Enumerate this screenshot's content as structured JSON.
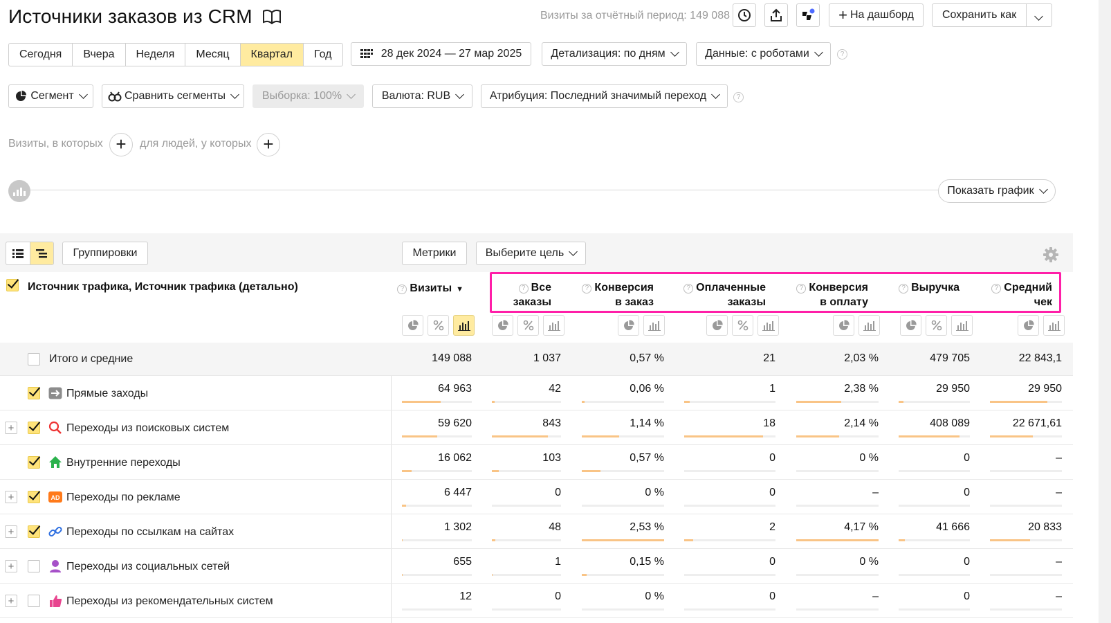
{
  "header": {
    "title": "Источники заказов из CRM",
    "visits_period": "Визиты за отчётный период: 149 088",
    "add_dashboard": "На дашборд",
    "save_as": "Сохранить как"
  },
  "periods": [
    "Сегодня",
    "Вчера",
    "Неделя",
    "Месяц",
    "Квартал",
    "Год"
  ],
  "active_period": "Квартал",
  "date_range": "28 дек 2024 — 27 мар 2025",
  "detail": "Детализация: по дням",
  "data_mode": "Данные: с роботами",
  "filters": {
    "segment": "Сегмент",
    "compare": "Сравнить сегменты",
    "sample": "Выборка: 100%",
    "currency": "Валюта: RUB",
    "attribution": "Атрибуция: Последний значимый переход",
    "visits_where": "Визиты, в которых",
    "people_where": "для людей, у которых"
  },
  "chart": {
    "show_chart": "Показать график"
  },
  "table_toolbar": {
    "groupings": "Группировки",
    "metrics": "Метрики",
    "choose_goal": "Выберите цель"
  },
  "table": {
    "dimension_title": "Источник трафика, Источник трафика (детально)",
    "columns": [
      {
        "line1": "Визиты",
        "line2": ""
      },
      {
        "line1": "Все",
        "line2": "заказы"
      },
      {
        "line1": "Конверсия",
        "line2": "в заказ"
      },
      {
        "line1": "Оплаченные",
        "line2": "заказы"
      },
      {
        "line1": "Конверсия",
        "line2": "в оплату"
      },
      {
        "line1": "Выручка",
        "line2": ""
      },
      {
        "line1": "Средний",
        "line2": "чек"
      }
    ],
    "total": {
      "label": "Итого и средние",
      "values": [
        "149 088",
        "1 037",
        "0,57 %",
        "21",
        "2,03 %",
        "479 705",
        "22 843,1"
      ]
    },
    "rows": [
      {
        "label": "Прямые заходы",
        "icon": "arrow-right-icon",
        "values": [
          "64 963",
          "42",
          "0,06 %",
          "1",
          "2,38 %",
          "29 950",
          "29 950"
        ],
        "bars": [
          0.55,
          0.04,
          0.03,
          0.06,
          0.55,
          0.07,
          0.8
        ]
      },
      {
        "label": "Переходы из поисковых систем",
        "icon": "search-icon",
        "values": [
          "59 620",
          "843",
          "1,14 %",
          "18",
          "2,14 %",
          "408 089",
          "22 671,61"
        ],
        "bars": [
          0.5,
          0.81,
          0.45,
          0.86,
          0.52,
          0.85,
          0.6
        ]
      },
      {
        "label": "Внутренние переходы",
        "icon": "home-icon",
        "values": [
          "16 062",
          "103",
          "0,57 %",
          "0",
          "0 %",
          "0",
          "–"
        ],
        "bars": [
          0.14,
          0.1,
          0.23,
          0,
          0,
          0,
          0
        ]
      },
      {
        "label": "Переходы по рекламе",
        "icon": "ad-icon",
        "values": [
          "6 447",
          "0",
          "0 %",
          "0",
          "–",
          "0",
          "–"
        ],
        "bars": [
          0.06,
          0,
          0,
          0,
          0,
          0,
          0
        ]
      },
      {
        "label": "Переходы по ссылкам на сайтах",
        "icon": "link-icon",
        "values": [
          "1 302",
          "48",
          "2,53 %",
          "2",
          "4,17 %",
          "41 666",
          "20 833"
        ],
        "bars": [
          0.01,
          0.05,
          1.0,
          0.1,
          1.0,
          0.09,
          0.56
        ]
      },
      {
        "label": "Переходы из социальных сетей",
        "icon": "user-icon",
        "values": [
          "655",
          "1",
          "0,15 %",
          "0",
          "0 %",
          "0",
          "–"
        ],
        "bars": [
          0.01,
          0.01,
          0.06,
          0,
          0,
          0,
          0
        ]
      },
      {
        "label": "Переходы из рекомендательных систем",
        "icon": "thumbs-up-icon",
        "values": [
          "12",
          "0",
          "0 %",
          "0",
          "–",
          "0",
          "–"
        ],
        "bars": [
          0,
          0,
          0,
          0,
          0,
          0,
          0
        ]
      }
    ]
  },
  "colors": {
    "accent": "#ffeba0",
    "highlight": "#ff1fa8",
    "bar": "#f9c486"
  }
}
